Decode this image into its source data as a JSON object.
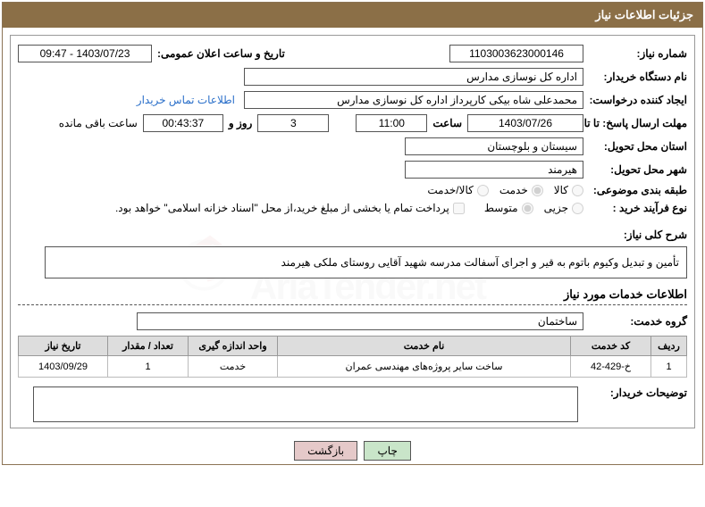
{
  "header": {
    "title": "جزئیات اطلاعات نیاز"
  },
  "fields": {
    "need_number_label": "شماره نیاز:",
    "need_number": "1103003623000146",
    "announce_label": "تاریخ و ساعت اعلان عمومی:",
    "announce_value": "1403/07/23 - 09:47",
    "buyer_org_label": "نام دستگاه خریدار:",
    "buyer_org": "اداره کل نوسازی مدارس",
    "creator_label": "ایجاد کننده درخواست:",
    "creator": "محمدعلی شاه بیکی کارپرداز اداره کل نوسازی مدارس",
    "contact_link": "اطلاعات تماس خریدار",
    "deadline_label": "مهلت ارسال پاسخ: تا تاریخ:",
    "deadline_date": "1403/07/26",
    "time_label": "ساعت",
    "deadline_time": "11:00",
    "days_remaining": "3",
    "days_and_label": "روز و",
    "time_remaining": "00:43:37",
    "remaining_label": "ساعت باقی مانده",
    "province_label": "استان محل تحویل:",
    "province": "سیستان و بلوچستان",
    "city_label": "شهر محل تحویل:",
    "city": "هیرمند",
    "subject_class_label": "طبقه بندی موضوعی:",
    "opt_kala": "کالا",
    "opt_khedmat": "خدمت",
    "opt_kala_khedmat": "کالا/خدمت",
    "purchase_type_label": "نوع فرآیند خرید :",
    "opt_small": "جزیی",
    "opt_medium": "متوسط",
    "payment_note": "پرداخت تمام یا بخشی از مبلغ خرید،از محل \"اسناد خزانه اسلامی\" خواهد بود.",
    "summary_label": "شرح کلی نیاز:",
    "summary": "تأمین و تبدیل وکیوم باتوم به قیر و اجرای آسفالت مدرسه شهید آقایی روستای ملکی هیرمند",
    "services_section": "اطلاعات خدمات مورد نیاز",
    "service_group_label": "گروه خدمت:",
    "service_group": "ساختمان",
    "buyer_notes_label": "توضیحات خریدار:"
  },
  "table": {
    "headers": {
      "row": "ردیف",
      "code": "کد خدمت",
      "name": "نام خدمت",
      "unit": "واحد اندازه گیری",
      "qty": "تعداد / مقدار",
      "date": "تاریخ نیاز"
    },
    "rows": [
      {
        "row": "1",
        "code": "خ-429-42",
        "name": "ساخت سایر پروژه‌های مهندسی عمران",
        "unit": "خدمت",
        "qty": "1",
        "date": "1403/09/29"
      }
    ]
  },
  "buttons": {
    "print": "چاپ",
    "back": "بازگشت"
  },
  "watermark": "AriaTender.net"
}
